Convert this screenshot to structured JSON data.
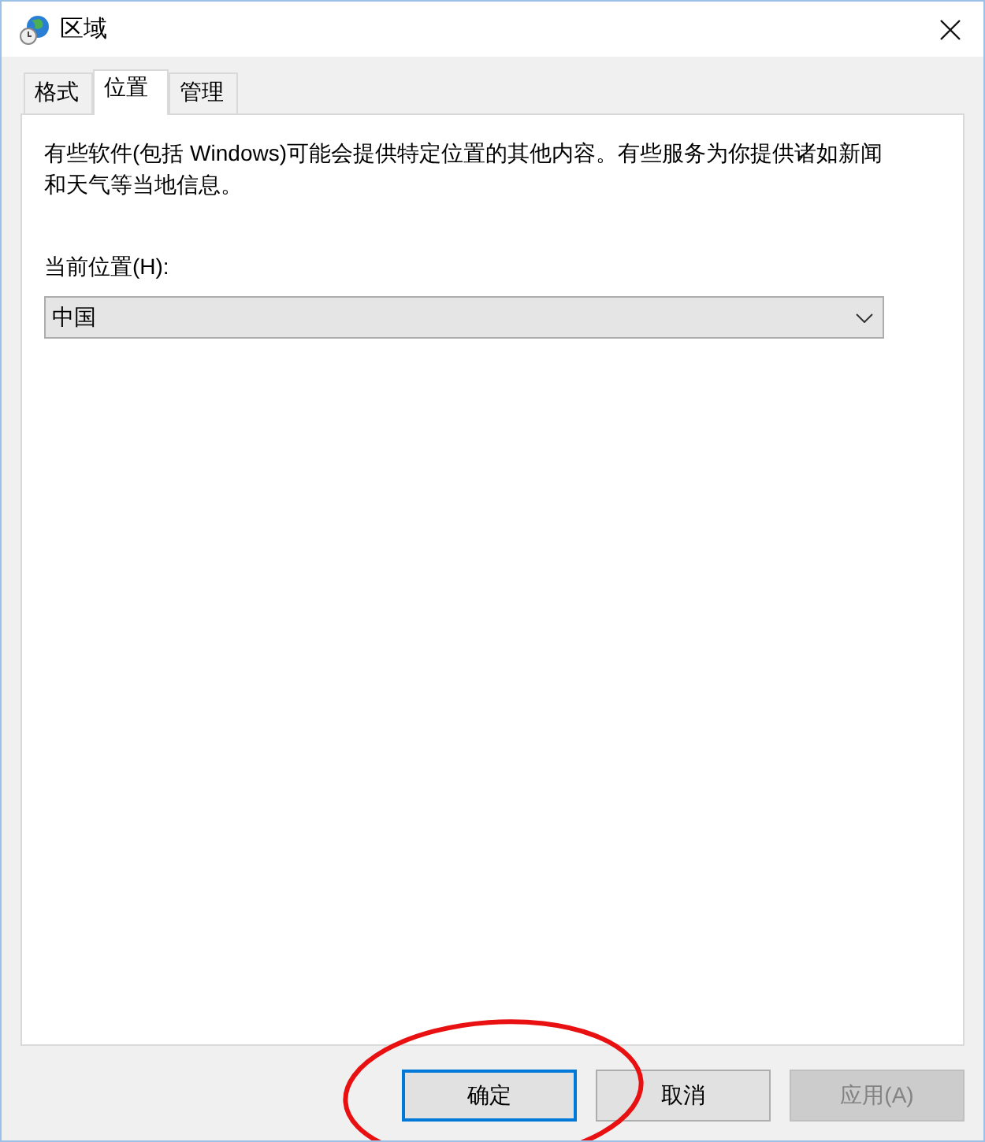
{
  "window": {
    "title": "区域"
  },
  "tabs": [
    {
      "label": "格式",
      "selected": false
    },
    {
      "label": "位置",
      "selected": true
    },
    {
      "label": "管理",
      "selected": false
    }
  ],
  "description": "有些软件(包括 Windows)可能会提供特定位置的其他内容。有些服务为你提供诸如新闻和天气等当地信息。",
  "location": {
    "label": "当前位置(H):",
    "value": "中国"
  },
  "buttons": [
    {
      "label": "确定",
      "default": true,
      "disabled": false
    },
    {
      "label": "取消",
      "default": false,
      "disabled": false
    },
    {
      "label": "应用(A)",
      "default": false,
      "disabled": true
    }
  ],
  "annotation": {
    "kind": "ellipse",
    "color": "#e81010"
  }
}
